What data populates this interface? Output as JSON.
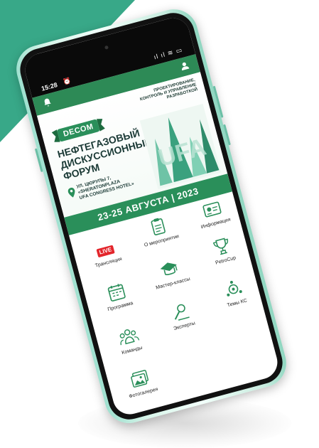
{
  "status_bar": {
    "time": "15:28",
    "alarm_icon": "alarm-clock-icon",
    "signals": "ıl ıl ≋ ▭"
  },
  "app_bar": {
    "left_icon": "bell-icon",
    "right_icon": "user-icon",
    "color": "#2d8a56"
  },
  "banner": {
    "tagline": "ПРОЕКТИРОВАНИЕ, КОНТРОЛЬ И УПРАВЛЕНИЕ РАЗРАБОТКОЙ",
    "logo": "DECOM",
    "title_line1": "НЕФТЕГАЗОВЫЙ",
    "title_line2": "ДИСКУССИОННЫЙ",
    "title_line3": "ФОРУМ",
    "graphic_text": "UFA",
    "address_line1": "УЛ. ЦЮРУПЫ 7,",
    "address_line2": "«SHERATONPLAZA",
    "address_line3": "UFA CONGRESS HOTEL»",
    "date_banner": "23-25 АВГУСТА | 2023"
  },
  "menu": {
    "translation": {
      "badge": "LIVE",
      "label": "Трансляция"
    },
    "about": {
      "label": "О мероприятии",
      "icon": "clipboard-icon"
    },
    "info": {
      "label": "Информация",
      "icon": "id-card-icon"
    },
    "program": {
      "label": "Программа",
      "icon": "calendar-icon"
    },
    "masterclass": {
      "label": "Мастер-классы",
      "icon": "graduation-cap-icon"
    },
    "petrocup": {
      "label": "PetroCup",
      "icon": "trophy-icon"
    },
    "teams": {
      "label": "Команды",
      "icon": "team-icon"
    },
    "experts": {
      "label": "Эксперты",
      "icon": "expert-icon"
    },
    "topics": {
      "label": "Темы КС",
      "icon": "topics-icon"
    },
    "gallery": {
      "label": "Фотогалерея",
      "icon": "photo-gallery-icon"
    }
  },
  "colors": {
    "accent": "#2d8a56",
    "teal_bg": "#38a888",
    "live": "#e3262c"
  }
}
